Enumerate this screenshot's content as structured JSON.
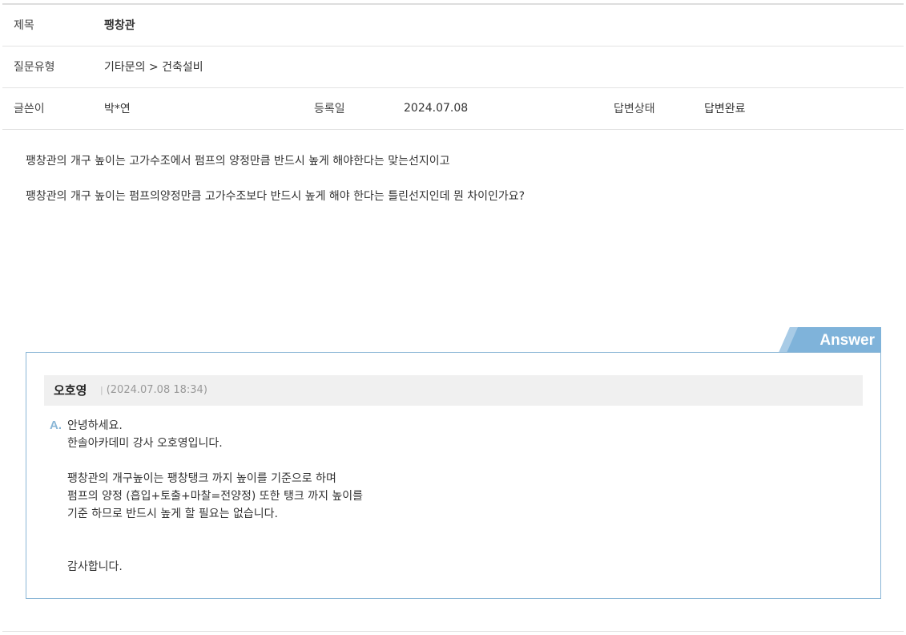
{
  "info": {
    "title_label": "제목",
    "title_value": "팽창관",
    "type_label": "질문유형",
    "type_value": "기타문의 > 건축설비",
    "author_label": "글쓴이",
    "author_value": "박*연",
    "date_label": "등록일",
    "date_value": "2024.07.08",
    "status_label": "답변상태",
    "status_value": "답변완료"
  },
  "question": {
    "lines": [
      "팽창관의 개구 높이는 고가수조에서 펌프의 양정만큼 반드시 높게 해야한다는 맞는선지이고",
      "팽창관의 개구 높이는 펌프의양정만큼 고가수조보다 반드시 높게 해야 한다는 틀린선지인데 뭔 차이인가요?"
    ]
  },
  "answer": {
    "tab_label": "Answer",
    "author": "오호영",
    "separator": "|",
    "date": "(2024.07.08 18:34)",
    "mark": "A.",
    "lines": [
      "안녕하세요.",
      "한솔아카데미 강사 오호영입니다.",
      "",
      "팽창관의 개구높이는 팽창탱크 까지 높이를 기준으로 하며",
      "펌프의 양정 (흡입+토출+마찰=전양정) 또한 탱크 까지 높이를",
      "기준 하므로 반드시 높게 할 필요는 없습니다.",
      "",
      "",
      "감사합니다."
    ]
  },
  "colors": {
    "answer_accent": "#8ab6d6",
    "answer_tab": "#7fb3da",
    "header_bg": "#f0f0f0",
    "border": "#e3e3e3"
  }
}
